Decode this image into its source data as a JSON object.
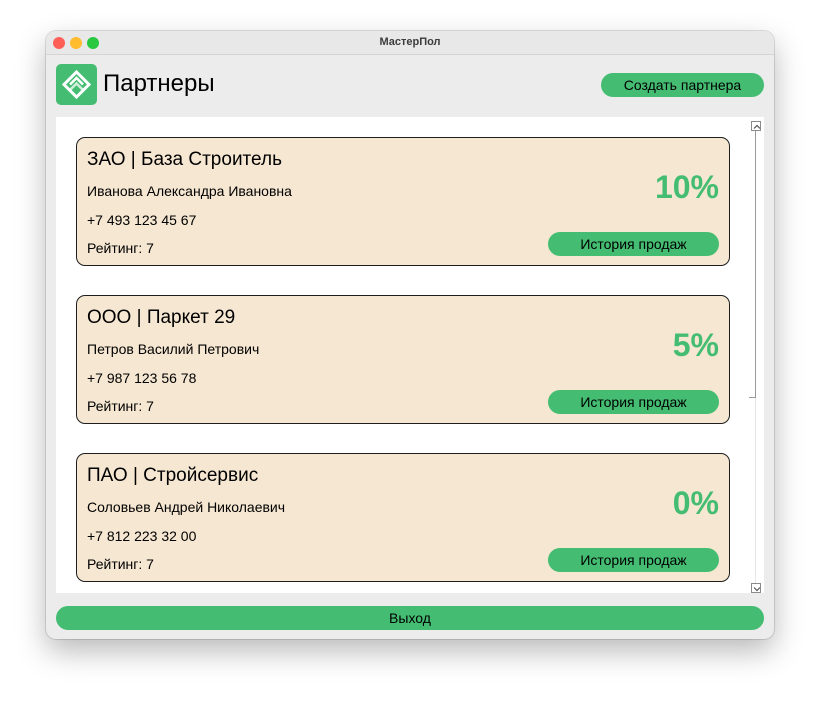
{
  "window": {
    "title": "МастерПол"
  },
  "header": {
    "logo_icon": "master-pol-logo-icon",
    "title": "Партнеры",
    "create_button": "Создать партнера"
  },
  "partners": [
    {
      "name": "ЗАО | База Строитель",
      "contact": "Иванова Александра Ивановна",
      "phone": "+7 493 123 45 67",
      "rating": "Рейтинг: 7",
      "discount": "10%",
      "history_button": "История продаж"
    },
    {
      "name": "ООО | Паркет 29",
      "contact": "Петров Василий Петрович",
      "phone": "+7 987 123 56 78",
      "rating": "Рейтинг: 7",
      "discount": "5%",
      "history_button": "История продаж"
    },
    {
      "name": "ПАО | Стройсервис",
      "contact": "Соловьев Андрей Николаевич",
      "phone": "+7 812 223 32 00",
      "rating": "Рейтинг: 7",
      "discount": "0%",
      "history_button": "История продаж"
    }
  ],
  "footer": {
    "exit_button": "Выход"
  },
  "colors": {
    "accent": "#44bd72",
    "card_background": "#f6e7d2",
    "window_background": "#ececec"
  }
}
